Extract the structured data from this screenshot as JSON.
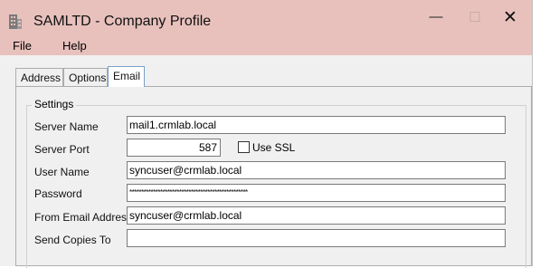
{
  "window": {
    "title": "SAMLTD - Company Profile",
    "icon": "building-icon",
    "controls": {
      "minimize": "—",
      "maximize": "☐",
      "close": "✕"
    },
    "titlebar_color": "#e8c1bd"
  },
  "menu": {
    "file": "File",
    "help": "Help"
  },
  "tabs": [
    {
      "label": "Address",
      "selected": false
    },
    {
      "label": "Options",
      "selected": false
    },
    {
      "label": "Email",
      "selected": true
    }
  ],
  "settings": {
    "group_title": "Settings",
    "server_name_label": "Server Name",
    "server_name_value": "mail1.crmlab.local",
    "server_port_label": "Server Port",
    "server_port_value": "587",
    "use_ssl_label": "Use SSL",
    "use_ssl_checked": false,
    "user_name_label": "User Name",
    "user_name_value": "syncuser@crmlab.local",
    "password_label": "Password",
    "password_value": "**************************************************",
    "from_email_label": "From Email Address",
    "from_email_value": "syncuser@crmlab.local",
    "send_copies_label": "Send Copies To",
    "send_copies_value": ""
  }
}
